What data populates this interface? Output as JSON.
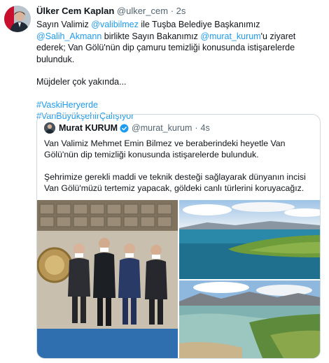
{
  "tweet": {
    "author_name": "Ülker Cem Kaplan",
    "author_handle": "@ulker_cem",
    "separator": "·",
    "time": "2s",
    "text_line1_pre": "Sayın Valimiz ",
    "mention_vali": "@valibilmez",
    "text_line1_mid": " ile Tuşba Belediye Başkanımız ",
    "mention_salih": "@Salih_Akmann",
    "text_line2_pre": " birlikte Sayın Bakanımız ",
    "mention_murat": "@murat_kurum",
    "text_line2_post": "'u ziyaret ederek; Van Gölü'nün dip çamuru temizliği konusunda istişarelerde bulunduk.",
    "text_para2": "Müjdeler çok yakında...",
    "hashtag1": "#VaskiHeryerde",
    "hashtag2": "#VanBüyükşehirÇalışıyor"
  },
  "quoted": {
    "author_name": "Murat KURUM",
    "author_handle": "@murat_kurum",
    "separator": "·",
    "time": "4s",
    "para1": "Van Valimiz Mehmet Emin Bilmez ve beraberindeki heyetle Van Gölü'nün dip temizliği konusunda istişarelerde bulunduk.",
    "para2": "Şehrimize gerekli maddi ve teknik desteği sağlayarak dünyanın incisi Van Gölü'müzü tertemiz yapacak, göldeki canlı türlerini koruyacağız."
  },
  "media": {
    "photos": [
      "group-meeting-photo",
      "lake-island-photo",
      "lake-shore-photo"
    ]
  },
  "colors": {
    "link": "#1d9bf0",
    "text": "#0f1419",
    "muted": "#536471",
    "border": "#cfd9de"
  }
}
